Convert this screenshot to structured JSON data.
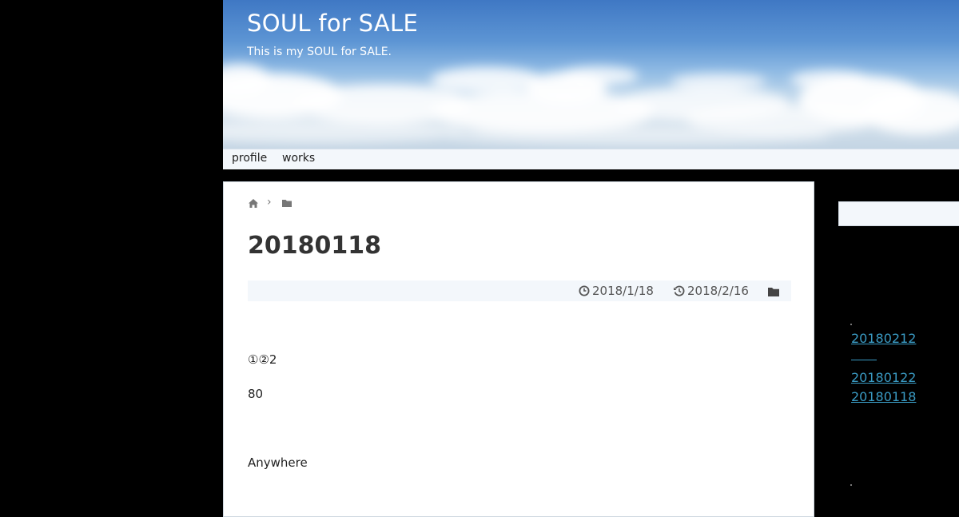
{
  "header": {
    "title": "SOUL for SALE",
    "description": "This is my SOUL for SALE."
  },
  "nav": {
    "items": [
      {
        "label": "profile"
      },
      {
        "label": "works"
      }
    ]
  },
  "breadcrumb": {
    "separator": "›",
    "icons": [
      "home-icon",
      "folder-icon"
    ]
  },
  "post": {
    "title": "20180118",
    "posted_date": "2018/1/18",
    "updated_date": "2018/2/16",
    "paragraphs": [
      "①②2",
      "80",
      "Anywhere"
    ]
  },
  "sidebar": {
    "links": [
      {
        "label": "20180212"
      },
      {
        "label": "20180122"
      },
      {
        "label": "20180118"
      }
    ]
  },
  "colors": {
    "background": "#000000",
    "link": "#3a9bc4",
    "meta_bar": "#f3f7fb",
    "title": "#333333"
  }
}
